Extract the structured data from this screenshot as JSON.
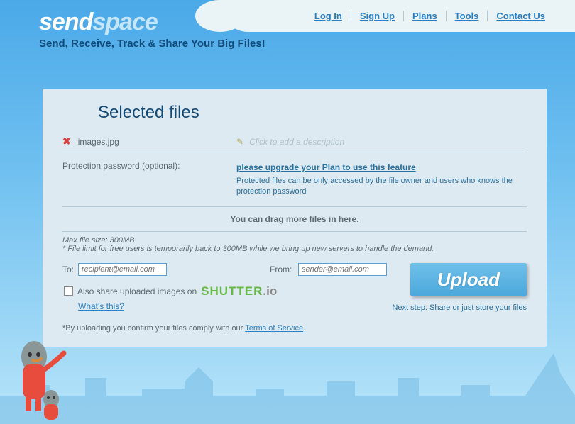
{
  "nav": {
    "login": "Log In",
    "signup": "Sign Up",
    "plans": "Plans",
    "tools": "Tools",
    "contact": "Contact Us"
  },
  "logo": {
    "part1": "send",
    "part2": "space"
  },
  "tagline": "Send, Receive, Track & Share Your Big Files!",
  "panel": {
    "title": "Selected files",
    "file_name": "images.jpg",
    "desc_placeholder": "Click to add a description",
    "password_label": "Protection password (optional):",
    "upgrade_text": "please upgrade your Plan to use this feature",
    "protected_text": "Protected files can be only accessed by the file owner and users who knows the protection password",
    "drag_text": "You can drag more files in here.",
    "max_size": "Max file size: 300MB",
    "limit_note": "* File limit for free users is temporarily back to 300MB while we bring up new servers to handle the demand.",
    "to_label": "To:",
    "from_label": "From:",
    "to_placeholder": "recipient@email.com",
    "from_placeholder": "sender@email.com",
    "shutter_label": "Also share uploaded images on",
    "shutter_brand": "SHUTTER",
    "shutter_suffix": ".io",
    "whats_this": "What's this?",
    "upload_label": "Upload",
    "next_step": "Next step: Share or just store your files",
    "tos_prefix": "*By uploading you confirm your files comply with our ",
    "tos_link": "Terms of Service",
    "tos_suffix": "."
  }
}
